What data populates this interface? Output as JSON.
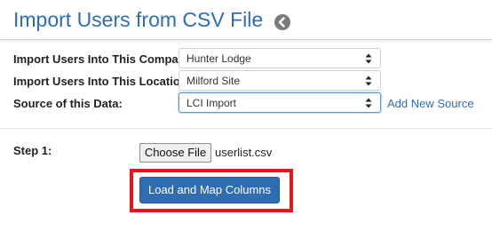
{
  "header": {
    "title": "Import Users from CSV File",
    "back_icon": "chevron-left-circle-icon"
  },
  "form": {
    "company": {
      "label": "Import Users Into This Company:",
      "value": "Hunter Lodge"
    },
    "location": {
      "label": "Import Users Into This Location:",
      "value": "Milford Site"
    },
    "source": {
      "label": "Source of this Data:",
      "value": "LCI Import",
      "add_link": "Add New Source"
    }
  },
  "step1": {
    "label": "Step 1:",
    "choose_file_label": "Choose File",
    "file_name": "userlist.csv",
    "submit_label": "Load and Map Columns"
  },
  "colors": {
    "accent": "#2d6db5",
    "button": "#2f6db3",
    "highlight": "#e8141c"
  }
}
